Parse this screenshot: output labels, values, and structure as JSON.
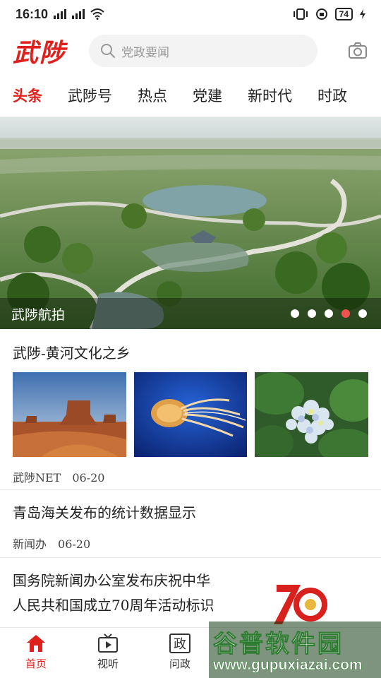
{
  "status_bar": {
    "time": "16:10",
    "battery": "74"
  },
  "header": {
    "logo": "武陟",
    "search_placeholder": "党政要闻"
  },
  "tabs": [
    "头条",
    "武陟号",
    "热点",
    "党建",
    "新时代",
    "时政"
  ],
  "active_tab": 0,
  "banner": {
    "title": "武陟航拍",
    "dot_count": 5,
    "active_dot": 3
  },
  "articles": [
    {
      "title": "武陟-黄河文化之乡",
      "source": "武陟NET",
      "date": "06-20"
    },
    {
      "title": "青岛海关发布的统计数据显示",
      "source": "新闻办",
      "date": "06-20"
    },
    {
      "title_line1": "国务院新闻办公室发布庆祝中华",
      "title_line2": "人民共和国成立70周年活动标识"
    }
  ],
  "bottom_nav": [
    {
      "label": "首页",
      "icon": "home-icon"
    },
    {
      "label": "视听",
      "icon": "tv-icon"
    },
    {
      "label": "问政",
      "icon": "zheng-icon",
      "icon_char": "政"
    }
  ],
  "watermark": {
    "text": "谷普软件园",
    "url": "www.gupuxiazai.com"
  },
  "colors": {
    "accent": "#e0201d",
    "active_dot": "#ef5350"
  }
}
